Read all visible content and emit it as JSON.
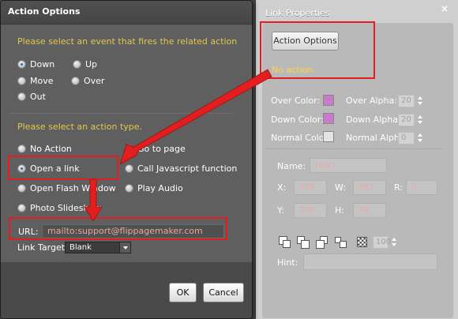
{
  "link_properties": {
    "title": "Link Properties",
    "close_glyph": "×",
    "action_options_button": "Action Options",
    "action_status": "No action.",
    "over_color_label": "Over Color:",
    "over_color": "#c97bc9",
    "over_alpha_label": "Over Alpha:",
    "over_alpha": "20",
    "down_color_label": "Down Color:",
    "down_color": "#c97bc9",
    "down_alpha_label": "Down Alpha:",
    "down_alpha": "20",
    "normal_color_label": "Normal Color:",
    "normal_color": "#e4e4e4",
    "normal_alpha_label": "Normal Alpha:",
    "normal_alpha": "0",
    "name_label": "Name:",
    "name_value": "Link1",
    "x_label": "X:",
    "x_value": "286",
    "w_label": "W:",
    "w_value": "282",
    "r_label": "R:",
    "r_value": "0",
    "y_label": "Y:",
    "y_value": "200",
    "h_label": "H:",
    "h_value": "38",
    "transparency_value": "100",
    "hint_label": "Hint:",
    "hint_value": ""
  },
  "action_dialog": {
    "title": "Action Options",
    "event_prompt": "Please select an event that fires the related action",
    "events": [
      {
        "label": "Down",
        "selected": true
      },
      {
        "label": "Up",
        "selected": false
      },
      {
        "label": "Move",
        "selected": false
      },
      {
        "label": "Over",
        "selected": false
      },
      {
        "label": "Out",
        "selected": false
      }
    ],
    "action_prompt": "Please select an action type.",
    "actions": [
      {
        "label": "No Action",
        "selected": false
      },
      {
        "label": "Go to page",
        "selected": false
      },
      {
        "label": "Open a link",
        "selected": true
      },
      {
        "label": "Call Javascript function",
        "selected": false
      },
      {
        "label": "Open Flash Window",
        "selected": false
      },
      {
        "label": "Play Audio",
        "selected": false
      },
      {
        "label": "Photo Slideshow",
        "selected": false
      }
    ],
    "url_label": "URL:",
    "url_value": "mailto:support@flippagemaker.com",
    "link_target_label": "Link Target:",
    "link_target_value": "Blank",
    "ok_label": "OK",
    "cancel_label": "Cancel"
  },
  "colors": {
    "hint_text": "#e2c84f",
    "annotation_red": "#e21e1e"
  }
}
